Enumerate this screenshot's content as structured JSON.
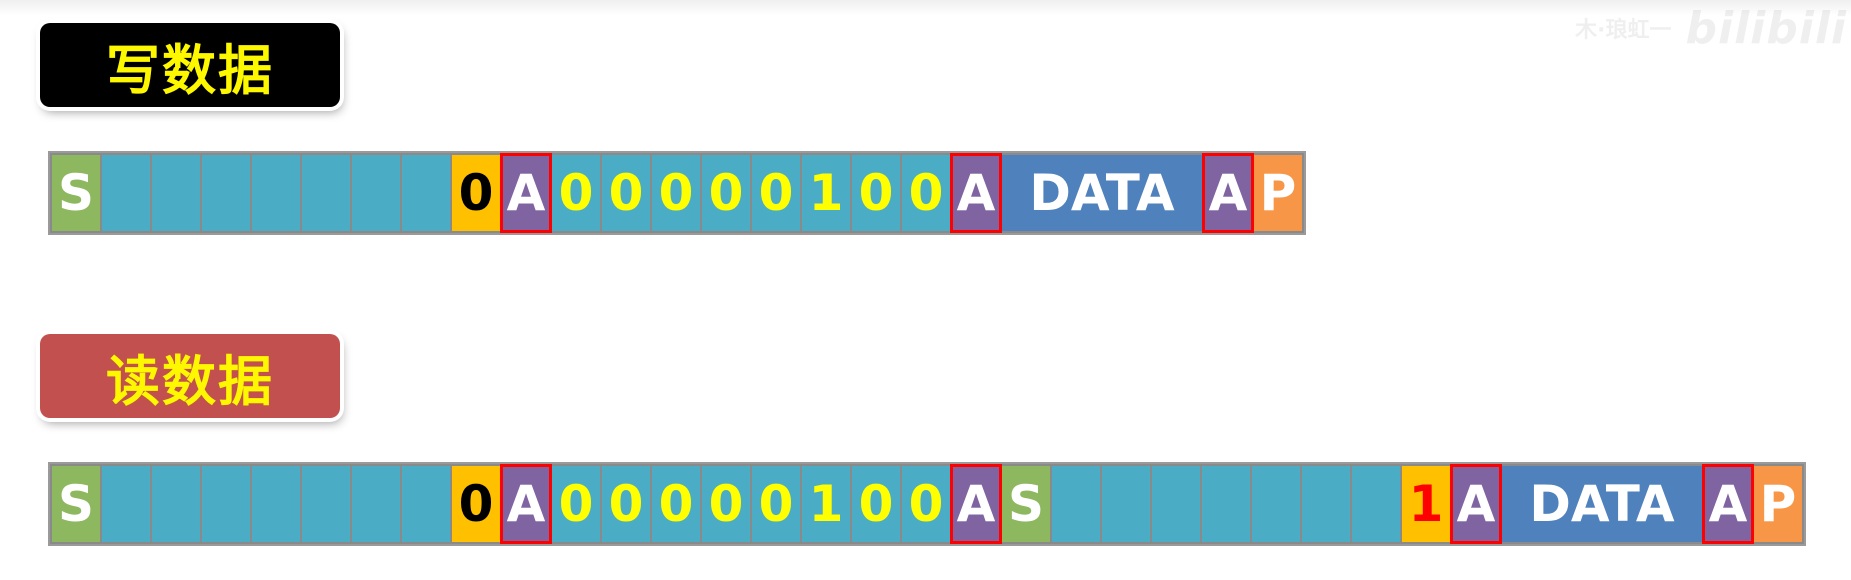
{
  "watermark": {
    "author": "木·琅虹一",
    "logo": "bilibili"
  },
  "write": {
    "title": "写数据",
    "frame": [
      {
        "type": "start",
        "label": "S"
      },
      {
        "type": "bit",
        "label": ""
      },
      {
        "type": "bit",
        "label": ""
      },
      {
        "type": "bit",
        "label": ""
      },
      {
        "type": "bit",
        "label": ""
      },
      {
        "type": "bit",
        "label": ""
      },
      {
        "type": "bit",
        "label": ""
      },
      {
        "type": "bit",
        "label": ""
      },
      {
        "type": "rw0",
        "label": "0"
      },
      {
        "type": "ack",
        "label": "A"
      },
      {
        "type": "bit",
        "label": "0"
      },
      {
        "type": "bit",
        "label": "0"
      },
      {
        "type": "bit",
        "label": "0"
      },
      {
        "type": "bit",
        "label": "0"
      },
      {
        "type": "bit",
        "label": "0"
      },
      {
        "type": "bit",
        "label": "1"
      },
      {
        "type": "bit",
        "label": "0"
      },
      {
        "type": "bit",
        "label": "0"
      },
      {
        "type": "ack",
        "label": "A"
      },
      {
        "type": "data",
        "label": "DATA"
      },
      {
        "type": "ack",
        "label": "A"
      },
      {
        "type": "stop",
        "label": "P"
      }
    ]
  },
  "read": {
    "title": "读数据",
    "frame": [
      {
        "type": "start",
        "label": "S"
      },
      {
        "type": "bit",
        "label": ""
      },
      {
        "type": "bit",
        "label": ""
      },
      {
        "type": "bit",
        "label": ""
      },
      {
        "type": "bit",
        "label": ""
      },
      {
        "type": "bit",
        "label": ""
      },
      {
        "type": "bit",
        "label": ""
      },
      {
        "type": "bit",
        "label": ""
      },
      {
        "type": "rw0",
        "label": "0"
      },
      {
        "type": "ack",
        "label": "A"
      },
      {
        "type": "bit",
        "label": "0"
      },
      {
        "type": "bit",
        "label": "0"
      },
      {
        "type": "bit",
        "label": "0"
      },
      {
        "type": "bit",
        "label": "0"
      },
      {
        "type": "bit",
        "label": "0"
      },
      {
        "type": "bit",
        "label": "1"
      },
      {
        "type": "bit",
        "label": "0"
      },
      {
        "type": "bit",
        "label": "0"
      },
      {
        "type": "ack",
        "label": "A"
      },
      {
        "type": "start",
        "label": "S"
      },
      {
        "type": "bit",
        "label": ""
      },
      {
        "type": "bit",
        "label": ""
      },
      {
        "type": "bit",
        "label": ""
      },
      {
        "type": "bit",
        "label": ""
      },
      {
        "type": "bit",
        "label": ""
      },
      {
        "type": "bit",
        "label": ""
      },
      {
        "type": "bit",
        "label": ""
      },
      {
        "type": "rw1",
        "label": "1"
      },
      {
        "type": "ack",
        "label": "A"
      },
      {
        "type": "data",
        "label": "DATA"
      },
      {
        "type": "ack",
        "label": "A"
      },
      {
        "type": "stop",
        "label": "P"
      }
    ]
  },
  "colors": {
    "start": "#8eb85f",
    "bit": "#4bacc6",
    "rw": "#ffc000",
    "ack": "#8064a2",
    "ack_border": "#ff0000",
    "data": "#4f81bd",
    "stop": "#f79646",
    "title_text": "#fdf700",
    "write_badge": "#000000",
    "read_badge": "#c1504f"
  }
}
